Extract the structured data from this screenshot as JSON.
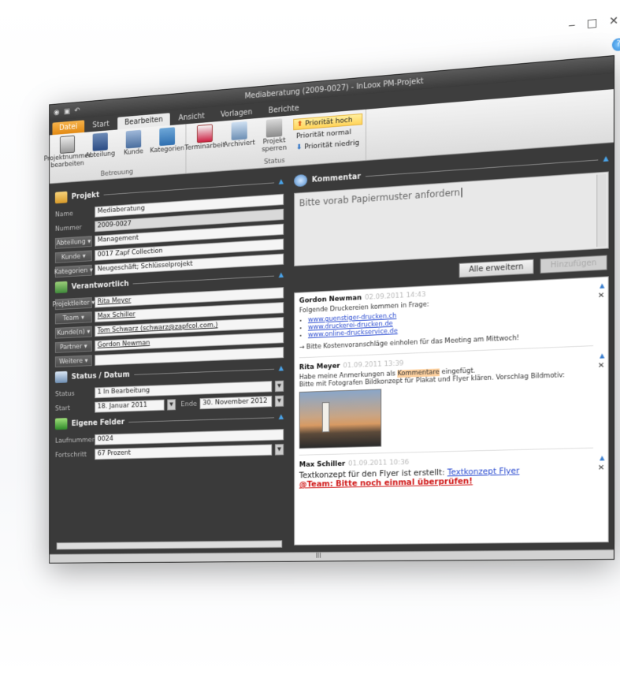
{
  "window": {
    "title": "Mediaberatung (2009-0027) - InLoox PM-Projekt",
    "controls": {
      "minimize": "‒",
      "maximize": "□",
      "close": "✕"
    },
    "help": "?"
  },
  "tabs": [
    "Datei",
    "Start",
    "Bearbeiten",
    "Ansicht",
    "Vorlagen",
    "Berichte"
  ],
  "ribbon": {
    "betreuung": {
      "label": "Betreuung",
      "buttons": [
        "Projektnummer bearbeiten",
        "Abteilung",
        "Kunde",
        "Kategorien"
      ]
    },
    "status": {
      "label": "Status",
      "buttons": [
        "Terminarbeit",
        "Archiviert",
        "Projekt sperren"
      ]
    },
    "priority": {
      "hoch": "Priorität hoch",
      "normal": "Priorität normal",
      "niedrig": "Priorität niedrig"
    }
  },
  "projekt": {
    "title": "Projekt",
    "name_label": "Name",
    "name": "Mediaberatung",
    "nummer_label": "Nummer",
    "nummer": "2009-0027",
    "abteilung_label": "Abteilung",
    "abteilung": "Management",
    "kunde_label": "Kunde",
    "kunde": "0017 Zapf Collection",
    "kategorien_label": "Kategorien",
    "kategorien": "Neugeschäft; Schlüsselprojekt"
  },
  "verantwortlich": {
    "title": "Verantwortlich",
    "rows": [
      {
        "label": "Projektleiter",
        "value": "Rita Meyer"
      },
      {
        "label": "Team",
        "value": "Max Schiller"
      },
      {
        "label": "Kunde(n)",
        "value": "Tom Schwarz (schwarz@zapfcol.com.)"
      },
      {
        "label": "Partner",
        "value": "Gordon Newman"
      },
      {
        "label": "Weitere",
        "value": ""
      }
    ]
  },
  "status": {
    "title": "Status / Datum",
    "status_label": "Status",
    "status": "1 In Bearbeitung",
    "start_label": "Start",
    "start": "18. Januar 2011",
    "ende_label": "Ende",
    "ende": "30. November 2012"
  },
  "eigene": {
    "title": "Eigene Felder",
    "lauf_label": "Laufnummer",
    "lauf": "0024",
    "fort_label": "Fortschritt",
    "fort": "67 Prozent"
  },
  "kommentar": {
    "title": "Kommentar",
    "text": "Bitte vorab Papiermuster anfordern",
    "expand_btn": "Alle erweitern",
    "add_btn": "Hinzufügen"
  },
  "feed": [
    {
      "author": "Gordon Newman",
      "date": "02.09.2011 14:43",
      "intro": "Folgende Druckereien kommen in Frage:",
      "links": [
        "www.guenstiger-drucken.ch",
        "www.druckerei-drucken.de",
        "www.online-druckservice.de"
      ],
      "note": "→ Bitte Kostenvoranschläge einholen für das Meeting am Mittwoch!"
    },
    {
      "author": "Rita Meyer",
      "date": "01.09.2011 13:39",
      "line1_a": "Habe meine Anmerkungen als ",
      "line1_hl": "Kommentare",
      "line1_b": " eingefügt.",
      "line2": "Bitte mit Fotografen Bildkonzept für Plakat und Flyer klären. Vorschlag Bildmotiv:"
    },
    {
      "author": "Max Schiller",
      "date": "01.09.2011 10:36",
      "text": "Textkonzept für den Flyer ist erstellt: ",
      "link": "Textkonzept Flyer",
      "red": "@Team: Bitte noch einmal überprüfen!"
    }
  ]
}
